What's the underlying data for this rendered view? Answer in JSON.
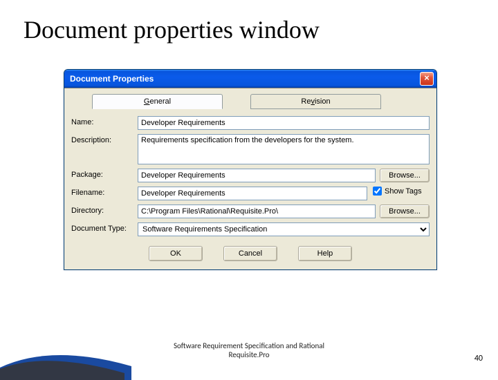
{
  "slide": {
    "title": "Document properties window",
    "caption_line1": "Software Requirement Specification and Rational",
    "caption_line2": "Requisite.Pro",
    "page_number": "40"
  },
  "dialog": {
    "title": "Document Properties",
    "close_glyph": "×",
    "tabs": {
      "general": "General",
      "revision": "Revision"
    },
    "labels": {
      "name": "Name:",
      "description": "Description:",
      "package": "Package:",
      "filename": "Filename:",
      "directory": "Directory:",
      "doctype": "Document Type:"
    },
    "values": {
      "name": "Developer Requirements",
      "description": "Requirements specification from the developers for the system.",
      "package": "Developer Requirements",
      "filename": "Developer Requirements",
      "directory": "C:\\Program Files\\Rational\\Requisite.Pro\\",
      "doctype": "Software Requirements Specification"
    },
    "buttons": {
      "browse": "Browse...",
      "ok": "OK",
      "cancel": "Cancel",
      "help": "Help"
    },
    "show_tags_label": "Show Tags"
  }
}
